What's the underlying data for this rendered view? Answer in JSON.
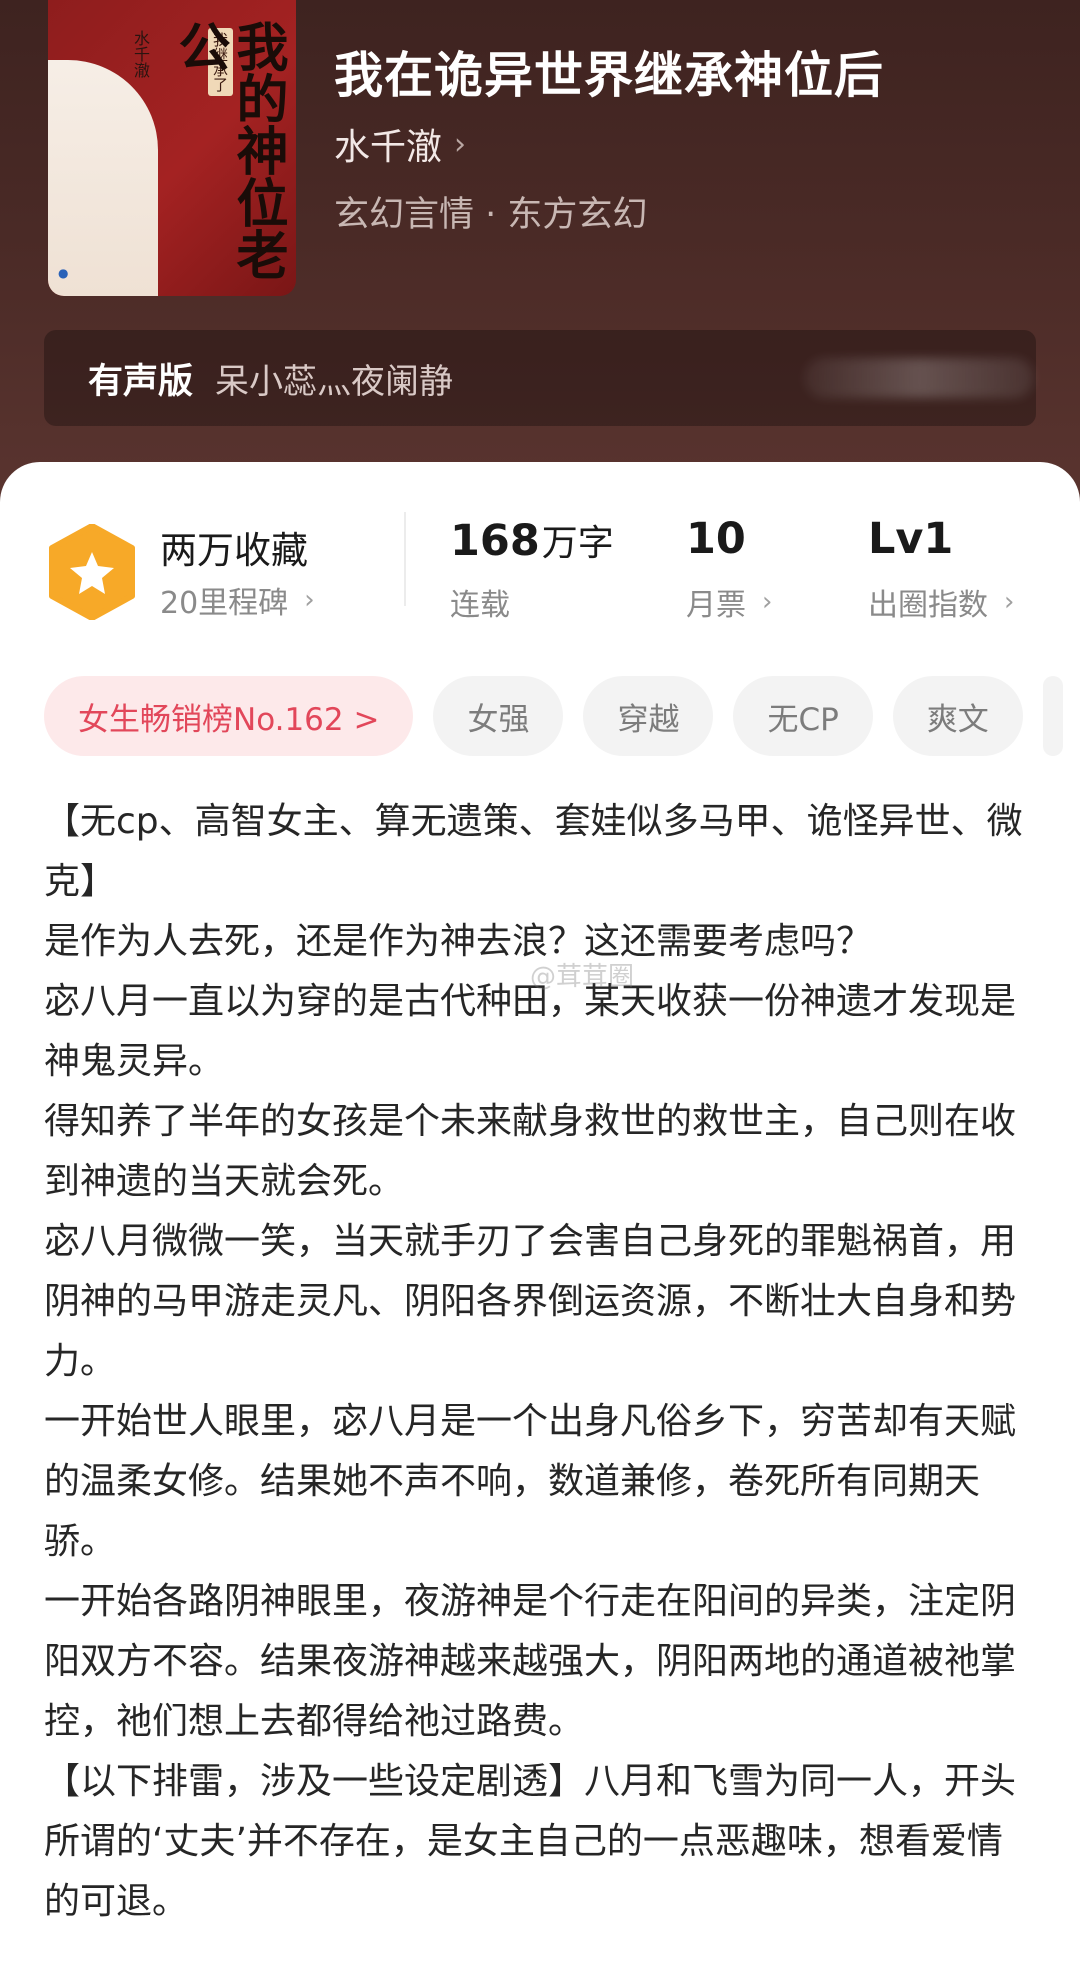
{
  "book": {
    "title": "我在诡异世界继承神位后",
    "author": "水千澈",
    "genre": "玄幻言情 · 东方玄幻"
  },
  "cover": {
    "title_text": "我的神位老公",
    "author_text": "水千澈",
    "sub_text": "我继承了"
  },
  "audio": {
    "label": "有声版",
    "narrators": "呆小蕊灬夜阑静"
  },
  "stats": {
    "collection_title": "两万收藏",
    "milestone": "20里程碑",
    "word_count_value": "168",
    "word_count_unit": "万字",
    "status": "连载",
    "monthly_tickets_value": "10",
    "monthly_tickets_label": "月票",
    "level_value": "Lv1",
    "level_label": "出圈指数"
  },
  "tags": [
    "女生畅销榜No.162 >",
    "女强",
    "穿越",
    "无CP",
    "爽文"
  ],
  "description": [
    "【无cp、高智女主、算无遗策、套娃似多马甲、诡怪异世、微克】",
    "是作为人去死，还是作为神去浪？这还需要考虑吗？",
    "宓八月一直以为穿的是古代种田，某天收获一份神遗才发现是神鬼灵异。",
    "得知养了半年的女孩是个未来献身救世的救世主，自己则在收到神遗的当天就会死。",
    "宓八月微微一笑，当天就手刃了会害自己身死的罪魁祸首，用阴神的马甲游走灵凡、阴阳各界倒运资源，不断壮大自身和势力。",
    "一开始世人眼里，宓八月是一个出身凡俗乡下，穷苦却有天赋的温柔女修。结果她不声不响，数道兼修，卷死所有同期天骄。",
    "一开始各路阴神眼里，夜游神是个行走在阳间的异类，注定阴阳双方不容。结果夜游神越来越强大，阴阳两地的通道被祂掌控，祂们想上去都得给祂过路费。",
    "【以下排雷，涉及一些设定剧透】八月和飞雪为同一人，开头所谓的‘丈夫’并不存在，是女主自己的一点恶趣味，想看爱情的可退。"
  ],
  "watermark": "@茸茸圈",
  "colors": {
    "header_bg": "#4a2a26",
    "badge_orange": "#f7a928",
    "rank_tag_text": "#e2475a",
    "rank_tag_bg": "#fde9ea"
  }
}
